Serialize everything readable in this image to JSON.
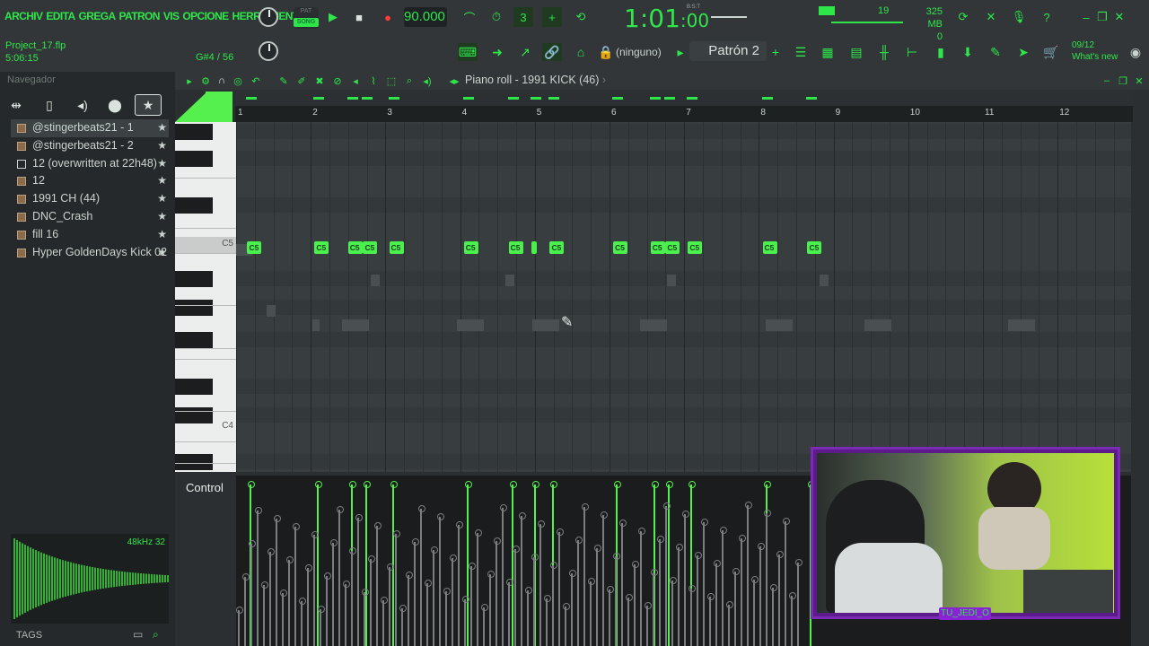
{
  "menu": [
    "ARCHIV",
    "EDITA",
    "GREGA",
    "PATRON",
    "VIS",
    "OPCIONE",
    "HERRAMIENTA"
  ],
  "project": {
    "name": "Project_17.flp",
    "elapsed": "5:06:15"
  },
  "hint": "G#4 / 56",
  "transport": {
    "pat_label": "PAT",
    "song_label": "SONG",
    "tempo": "90.000",
    "time_main": "1:01",
    "time_sub": ":00",
    "bst": "B:S:T"
  },
  "cpu": {
    "value": "19",
    "memory": "325 MB",
    "polyphony": "0"
  },
  "toolbar": {
    "pattern_selector": "(ninguno)",
    "pattern_name": "Patrón 2",
    "news_date": "09/12",
    "news_label": "What's new"
  },
  "browser": {
    "title": "Navegador",
    "items": [
      {
        "label": "@stingerbeats21 - 1",
        "type": "audio",
        "selected": true
      },
      {
        "label": "@stingerbeats21 - 2",
        "type": "audio"
      },
      {
        "label": "12 (overwritten at 22h48)",
        "type": "doc"
      },
      {
        "label": "12",
        "type": "audio"
      },
      {
        "label": "1991 CH (44)",
        "type": "audio"
      },
      {
        "label": "DNC_Crash",
        "type": "audio"
      },
      {
        "label": "fill 16",
        "type": "audio"
      },
      {
        "label": "Hyper GoldenDays Kick 02",
        "type": "audio"
      }
    ],
    "wave_info": "48kHz 32",
    "tags_label": "TAGS"
  },
  "piano_roll": {
    "title_prefix": "Piano roll - ",
    "title_channel": "1991 KICK (46)",
    "bars": [
      "1",
      "2",
      "3",
      "4",
      "5",
      "6",
      "7",
      "8",
      "9",
      "10",
      "11",
      "12"
    ],
    "key_labels": {
      "c5": "C5",
      "c4": "C4"
    },
    "note_label": "C5",
    "notes_bar_pos": [
      1.15,
      2.05,
      2.5,
      2.7,
      3.05,
      4.05,
      4.65,
      4.95,
      5.2,
      6.05,
      6.55,
      6.75,
      7.05,
      8.05,
      8.65
    ]
  },
  "control": {
    "label": "Control"
  },
  "webcam": {
    "tag": "TU_JEDI_O"
  }
}
